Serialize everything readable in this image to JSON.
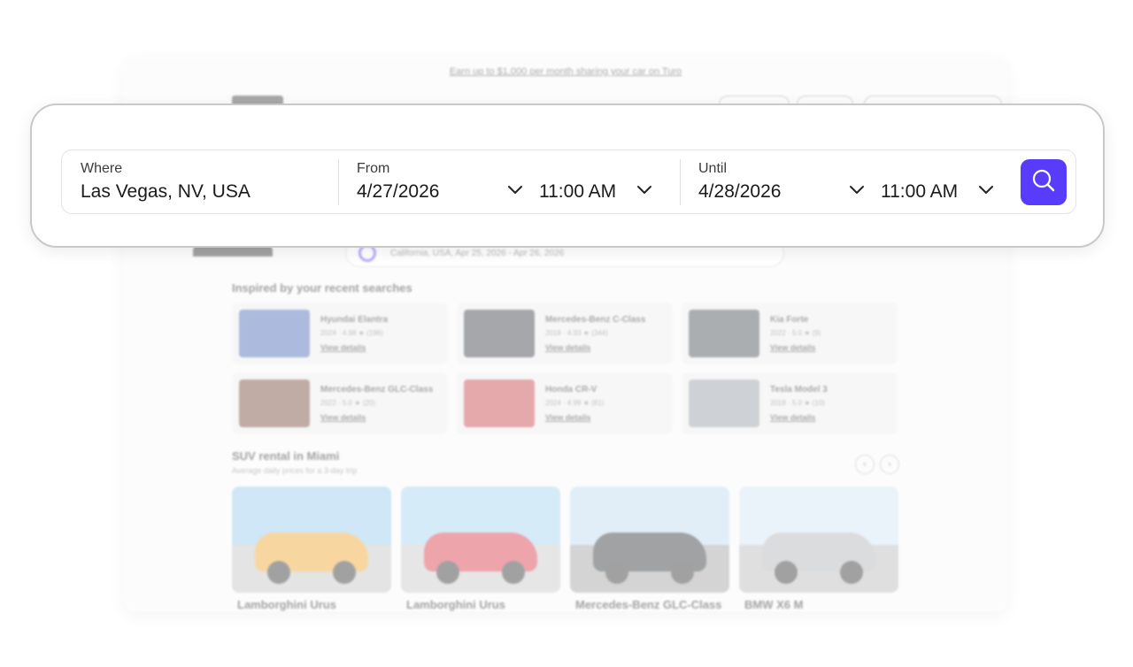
{
  "background": {
    "banner_text": "Earn up to $1,000 per month sharing your car on Turo",
    "search_summary": "California, USA, Apr 25, 2026 - Apr 26, 2026",
    "recent_heading": "Inspired by your recent searches",
    "recent_cards": [
      {
        "name": "Hyundai Elantra",
        "meta": "2024 · 4.98 ★ (196)",
        "link": "View details",
        "thumb_color": "#3b5fb0"
      },
      {
        "name": "Mercedes-Benz C-Class",
        "meta": "2018 · 4.93 ★ (344)",
        "link": "View details",
        "thumb_color": "#2a2f38"
      },
      {
        "name": "Kia Forte",
        "meta": "2022 · 5.0 ★ (9)",
        "link": "View details",
        "thumb_color": "#3a3f48"
      },
      {
        "name": "Mercedes-Benz GLC-Class",
        "meta": "2022 · 5.0 ★ (20)",
        "link": "View details",
        "thumb_color": "#6b3a2a"
      },
      {
        "name": "Honda CR-V",
        "meta": "2024 · 4.99 ★ (81)",
        "link": "View details",
        "thumb_color": "#c2323a"
      },
      {
        "name": "Tesla Model 3",
        "meta": "2018 · 5.0 ★ (10)",
        "link": "View details",
        "thumb_color": "#8d949c"
      }
    ],
    "suv_heading": "SUV rental in Miami",
    "suv_sub": "Average daily prices for a 3-day trip",
    "arrow_prev": "‹",
    "arrow_next": "›",
    "suv_cards": [
      {
        "name": "Lamborghini Urus",
        "car_color": "#f0a020",
        "sky_color": "#8fc7ec"
      },
      {
        "name": "Lamborghini Urus",
        "car_color": "#d8283a",
        "sky_color": "#9fd0ef"
      },
      {
        "name": "Mercedes-Benz GLC-Class",
        "car_color": "#1e2428",
        "sky_color": "#b9d9ef"
      },
      {
        "name": "BMW X6 M",
        "car_color": "#a9adb2",
        "sky_color": "#cfe3f2"
      }
    ]
  },
  "search": {
    "where_label": "Where",
    "where_value": "Las Vegas, NV, USA",
    "from_label": "From",
    "from_date": "4/27/2026",
    "from_time": "11:00 AM",
    "until_label": "Until",
    "until_date": "4/28/2026",
    "until_time": "11:00 AM",
    "button_icon": "search-icon",
    "accent_color": "#593cfb"
  }
}
